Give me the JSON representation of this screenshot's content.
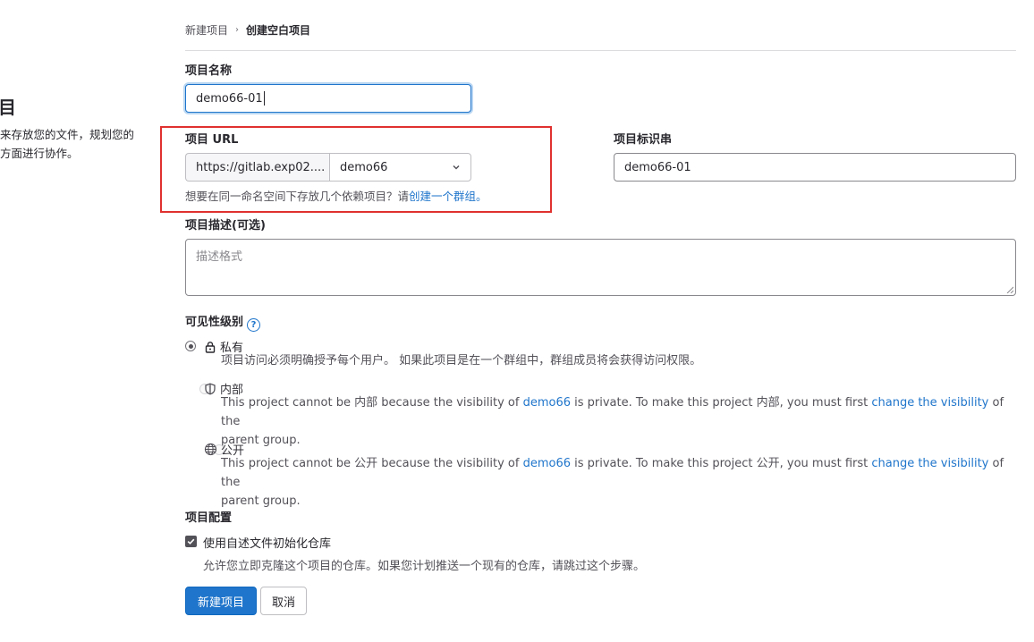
{
  "left_panel": {
    "title_fragment": "目",
    "desc_line1": "来存放您的文件，规划您的",
    "desc_line2": "方面进行协作。"
  },
  "breadcrumb": {
    "parent": "新建项目",
    "current": "创建空白项目"
  },
  "project_name": {
    "label": "项目名称",
    "value": "demo66-01"
  },
  "project_url": {
    "label": "项目 URL",
    "prefix": "https://gitlab.exp02....",
    "namespace": "demo66",
    "help_prefix": "想要在同一命名空间下存放几个依赖项目？请",
    "help_link": "创建一个群组。"
  },
  "project_slug": {
    "label": "项目标识串",
    "value": "demo66-01"
  },
  "description": {
    "label": "项目描述(可选)",
    "placeholder": "描述格式"
  },
  "visibility": {
    "label": "可见性级别",
    "help_icon": "question-circle-icon",
    "options": [
      {
        "name": "私有",
        "icon": "lock-icon",
        "checked": true,
        "desc": "项目访问必须明确授予每个用户。 如果此项目是在一个群组中，群组成员将会获得访问权限。"
      },
      {
        "name": "内部",
        "icon": "shield-icon",
        "checked": false,
        "desc_a": "This project cannot be 内部 because the visibility of ",
        "desc_link1": "demo66",
        "desc_b": " is private. To make this project 内部, you must first ",
        "desc_link2": "change the visibility",
        "desc_c": " of the",
        "desc_line2": "parent group."
      },
      {
        "name": "公开",
        "icon": "globe-icon",
        "checked": false,
        "desc_a": "This project cannot be 公开 because the visibility of ",
        "desc_link1": "demo66",
        "desc_b": " is private. To make this project 公开, you must first ",
        "desc_link2": "change the visibility",
        "desc_c": " of the",
        "desc_line2": "parent group."
      }
    ]
  },
  "config": {
    "label": "项目配置",
    "readme_checkbox": "使用自述文件初始化仓库",
    "readme_checked": true,
    "readme_help": "允许您立即克隆这个项目的仓库。如果您计划推送一个现有的仓库，请跳过这个步骤。"
  },
  "actions": {
    "create": "新建项目",
    "cancel": "取消"
  },
  "colors": {
    "primary": "#1f75cb",
    "highlight_box": "#e0312f"
  }
}
